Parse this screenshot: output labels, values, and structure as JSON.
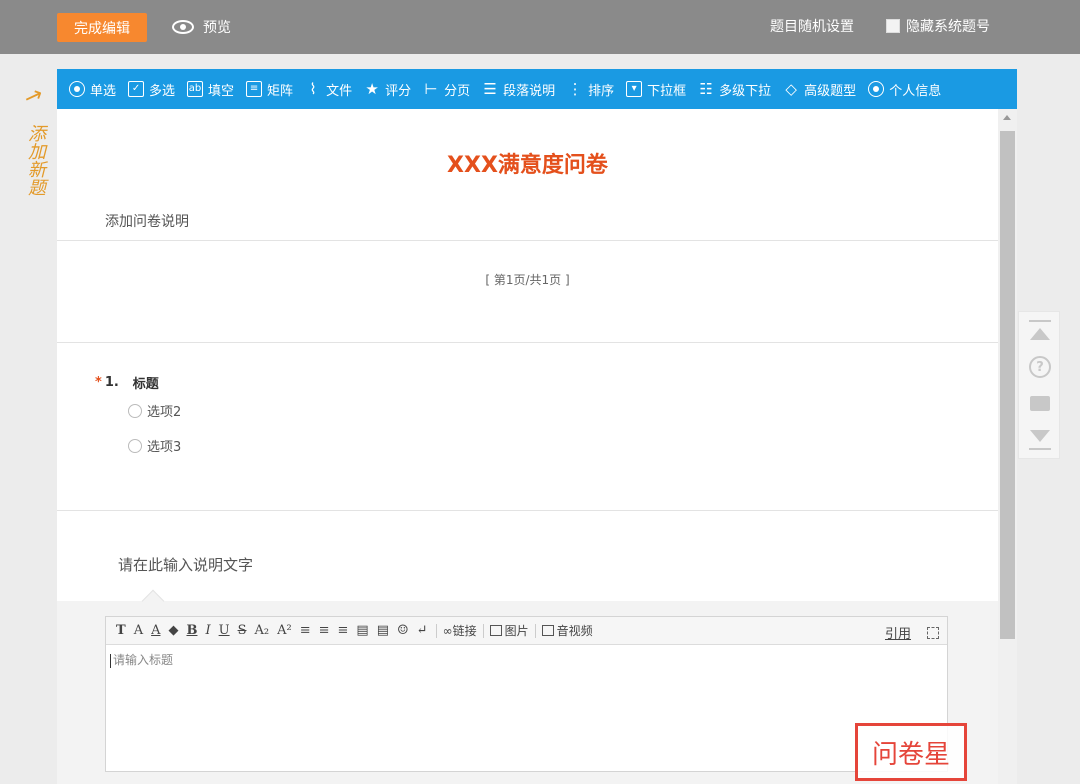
{
  "topbar": {
    "finish_label": "完成编辑",
    "preview_label": "预览",
    "random_settings_label": "题目随机设置",
    "hide_system_label": "隐藏系统题号"
  },
  "side_note": {
    "arrow": "↗",
    "text": "添加新题"
  },
  "question_types": [
    {
      "label": "单选",
      "icon": "radio-icon"
    },
    {
      "label": "多选",
      "icon": "checkbox-icon"
    },
    {
      "label": "填空",
      "icon": "fill-blank-icon"
    },
    {
      "label": "矩阵",
      "icon": "matrix-icon"
    },
    {
      "label": "文件",
      "icon": "paperclip-icon"
    },
    {
      "label": "评分",
      "icon": "stars-icon"
    },
    {
      "label": "分页",
      "icon": "page-break-icon"
    },
    {
      "label": "段落说明",
      "icon": "paragraph-icon"
    },
    {
      "label": "排序",
      "icon": "sort-icon"
    },
    {
      "label": "下拉框",
      "icon": "dropdown-icon"
    },
    {
      "label": "多级下拉",
      "icon": "multi-dropdown-icon"
    },
    {
      "label": "高级题型",
      "icon": "diamond-icon"
    },
    {
      "label": "个人信息",
      "icon": "user-icon"
    }
  ],
  "survey": {
    "title": "XXX满意度问卷",
    "add_description": "添加问卷说明",
    "page_indicator": "[ 第1页/共1页 ]"
  },
  "question": {
    "required_mark": "*",
    "number": "1.",
    "title": "标题",
    "options": [
      "选项2",
      "选项3"
    ]
  },
  "description_block": {
    "text": "请在此输入说明文字"
  },
  "editor": {
    "link_label": "链接",
    "image_label": "图片",
    "media_label": "音视频",
    "quote_label": "引用",
    "placeholder": "请输入标题"
  },
  "watermark": "问卷星"
}
